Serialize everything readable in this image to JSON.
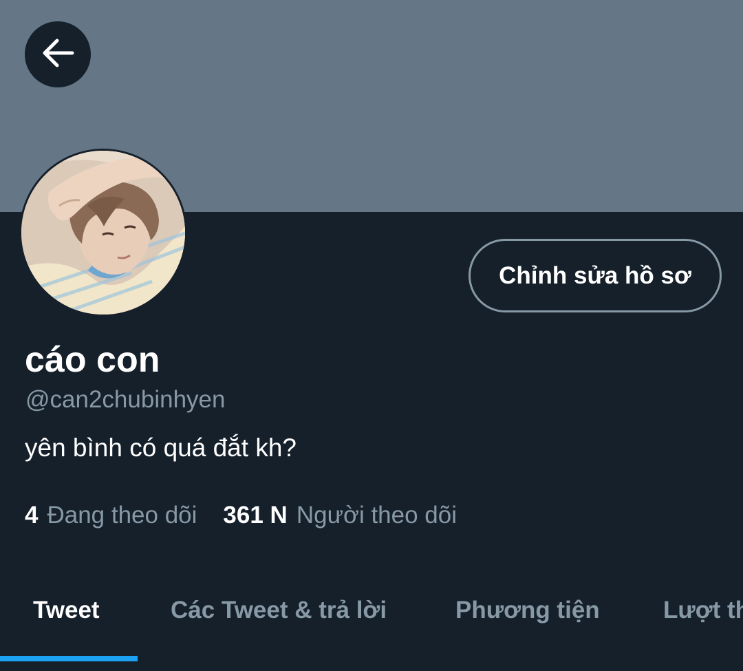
{
  "header": {
    "back_icon": "arrow-left-icon",
    "banner_color": "#657786"
  },
  "profile": {
    "display_name": "cáo con",
    "handle": "@can2chubinhyen",
    "bio": "yên bình có quá đắt kh?",
    "edit_button_label": "Chỉnh sửa hồ sơ"
  },
  "stats": {
    "following_count": "4",
    "following_label": "Đang theo dõi",
    "followers_count": "361 N",
    "followers_label": "Người theo dõi"
  },
  "tabs": [
    {
      "label": "Tweet",
      "active": true
    },
    {
      "label": "Các Tweet & trả lời",
      "active": false
    },
    {
      "label": "Phương tiện",
      "active": false
    },
    {
      "label": "Lượt thích",
      "active": false
    }
  ],
  "colors": {
    "background": "#15202b",
    "accent": "#1da1f2",
    "secondary_text": "#8899a6"
  }
}
